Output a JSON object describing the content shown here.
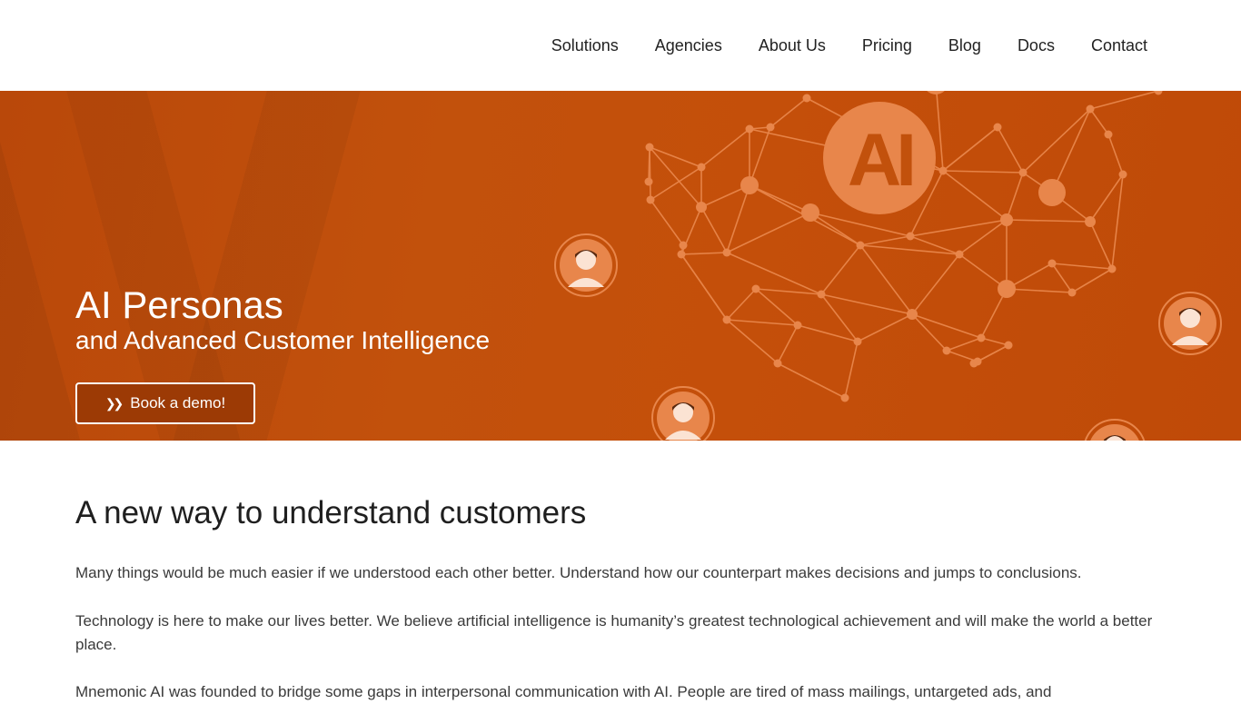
{
  "nav": {
    "items": [
      "Solutions",
      "Agencies",
      "About Us",
      "Pricing",
      "Blog",
      "Docs",
      "Contact"
    ]
  },
  "hero": {
    "title": "AI Personas",
    "subtitle": "and Advanced Customer Intelligence",
    "cta_label": "Book a demo!",
    "cta_icon": "double-chevron-right-icon",
    "badge_text": "AI",
    "background_color": "#c2510c",
    "network_color": "#e8864b"
  },
  "main": {
    "heading": "A new way to understand customers",
    "paragraphs": [
      "Many things would be much easier if we understood each other better. Understand how our counterpart makes decisions and jumps to conclusions.",
      "Technology is here to make our lives better. We believe artificial intelligence is humanity’s greatest technological achievement and will make the world a better place.",
      "Mnemonic AI was founded to bridge some gaps in interpersonal communication with AI. People are tired of mass mailings, untargeted ads, and"
    ]
  }
}
